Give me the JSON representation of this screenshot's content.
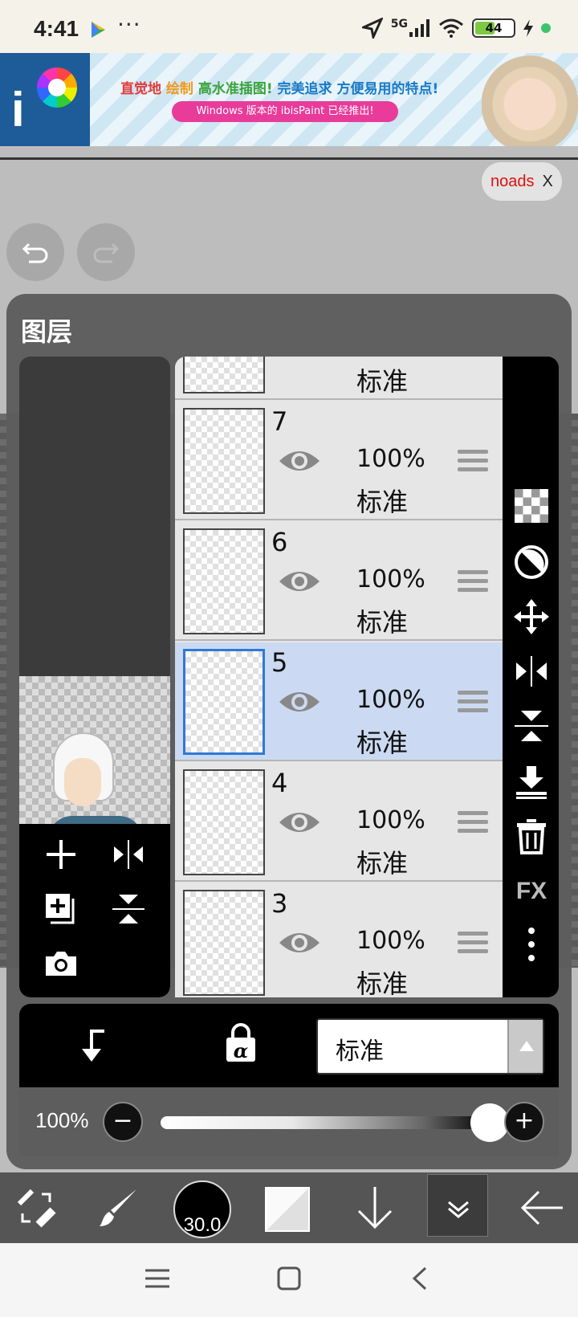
{
  "status_bar": {
    "time": "4:41",
    "more": "···",
    "network": "5G",
    "battery": "44"
  },
  "ad": {
    "headline_1": "直觉地",
    "headline_2": "绘制",
    "headline_3": "高水准插图!",
    "headline_4": "完美追求",
    "headline_5": "方便易用的特点!",
    "subline": "Windows 版本的 ibisPaint 已经推出!"
  },
  "noads": {
    "label": "noads",
    "close": "X"
  },
  "panel": {
    "title": "图层"
  },
  "layers": [
    {
      "number": "",
      "opacity": "",
      "mode": "标准"
    },
    {
      "number": "7",
      "opacity": "100%",
      "mode": "标准"
    },
    {
      "number": "6",
      "opacity": "100%",
      "mode": "标准"
    },
    {
      "number": "5",
      "opacity": "100%",
      "mode": "标准",
      "selected": true
    },
    {
      "number": "4",
      "opacity": "100%",
      "mode": "标准"
    },
    {
      "number": "3",
      "opacity": "100%",
      "mode": "标准"
    }
  ],
  "side_tools": {
    "fx": "FX"
  },
  "blend": {
    "value": "标准"
  },
  "opacity_bar": {
    "value": "100%",
    "minus": "−",
    "plus": "+",
    "level": 1.0
  },
  "toolbar": {
    "brush_size": "30.0"
  },
  "colors": {
    "selected_layer": "#cbdaf2",
    "accent": "#2f79d6",
    "noads_text": "#dd1111"
  }
}
